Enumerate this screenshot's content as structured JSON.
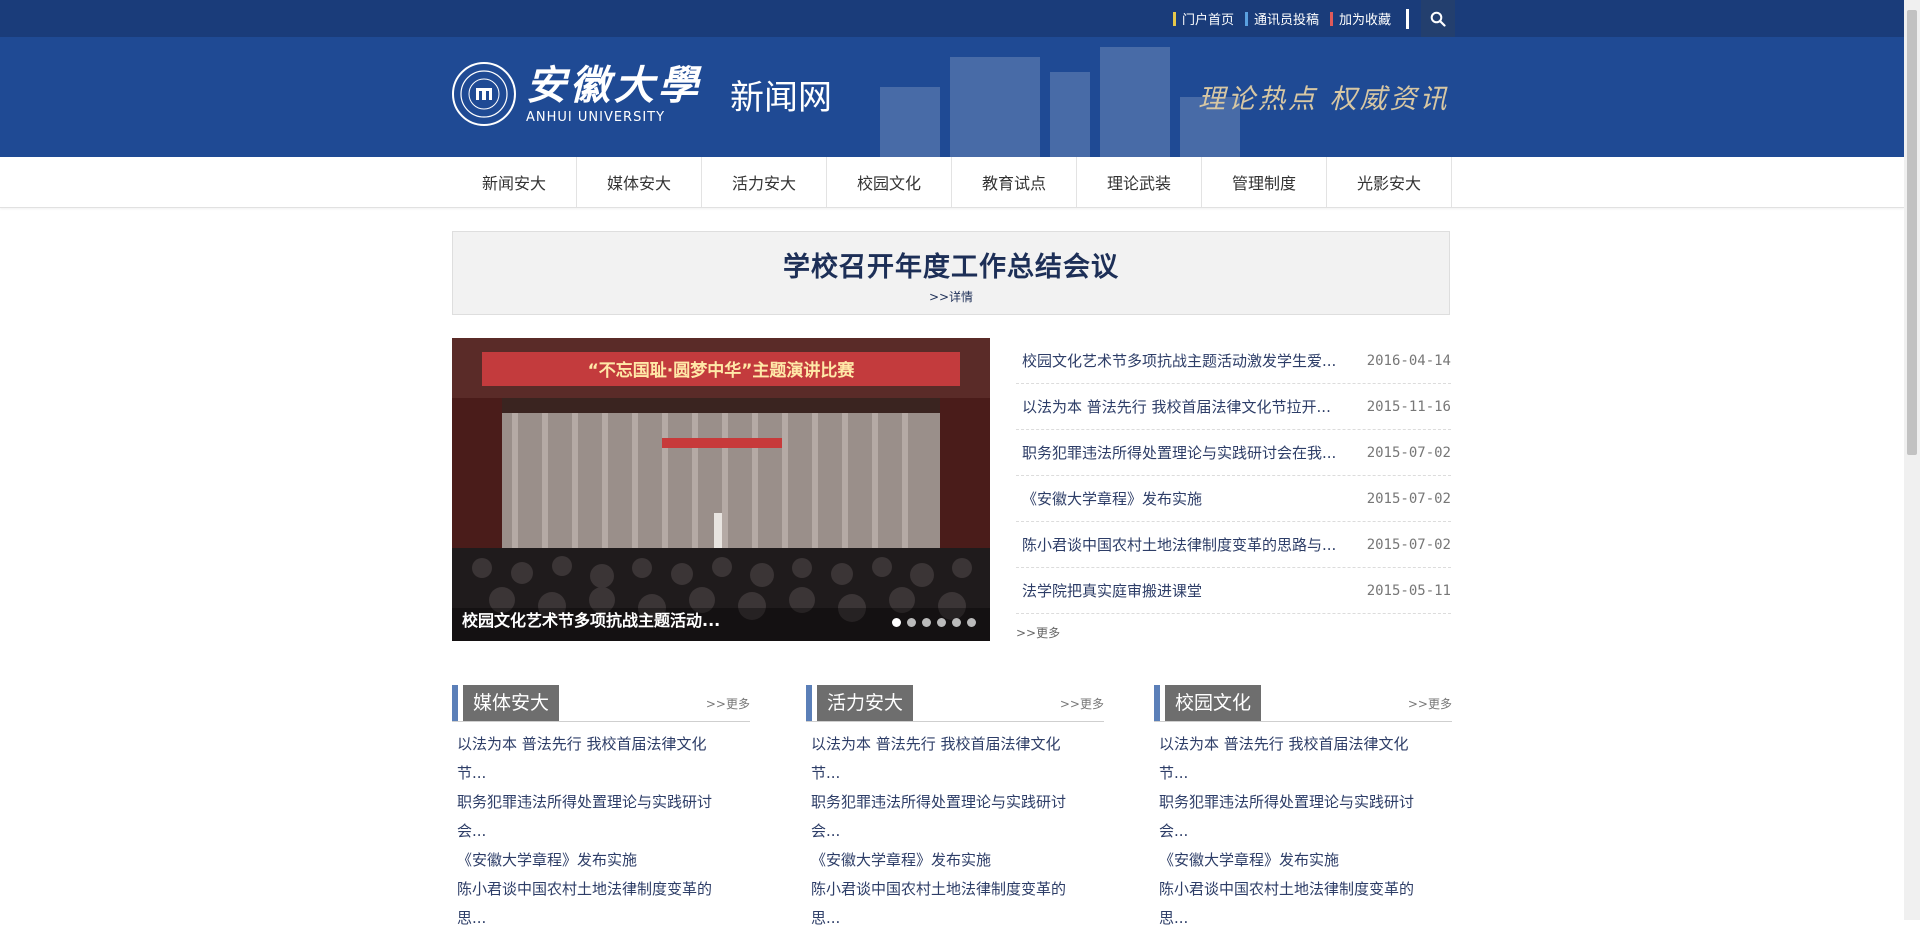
{
  "topbar": {
    "links": [
      {
        "label": "门户首页",
        "color": "#e6c84a"
      },
      {
        "label": "通讯员投稿",
        "color": "#5aa0e0"
      },
      {
        "label": "加为收藏",
        "color": "#e05a5a"
      }
    ],
    "search_icon": "search-icon"
  },
  "header": {
    "logo_cn": "安徽大學",
    "logo_en": "ANHUI UNIVERSITY",
    "site_name": "新闻网",
    "slogan": "理论热点 权威资讯"
  },
  "nav": {
    "items": [
      "新闻安大",
      "媒体安大",
      "活力安大",
      "校园文化",
      "教育试点",
      "理论武装",
      "管理制度",
      "光影安大"
    ]
  },
  "headline": {
    "title": "学校召开年度工作总结会议",
    "detail": ">>详情"
  },
  "slider": {
    "caption": "校园文化艺术节多项抗战主题活动...",
    "banner_text": "“不忘国耻·圆梦中华”主题演讲比赛",
    "dot_count": 6,
    "active_dot": 1
  },
  "news": {
    "items": [
      {
        "title": "校园文化艺术节多项抗战主题活动激发学生爱...",
        "date": "2016-04-14"
      },
      {
        "title": "以法为本 普法先行 我校首届法律文化节拉开...",
        "date": "2015-11-16"
      },
      {
        "title": "职务犯罪违法所得处置理论与实践研讨会在我...",
        "date": "2015-07-02"
      },
      {
        "title": "《安徽大学章程》发布实施",
        "date": "2015-07-02"
      },
      {
        "title": "陈小君谈中国农村土地法律制度变革的思路与...",
        "date": "2015-07-02"
      },
      {
        "title": "法学院把真实庭审搬进课堂",
        "date": "2015-05-11"
      }
    ],
    "more": ">>更多"
  },
  "columns": [
    {
      "title": "媒体安大",
      "more": ">>更多",
      "items": [
        "以法为本 普法先行 我校首届法律文化",
        "节...",
        "职务犯罪违法所得处置理论与实践研讨",
        "会...",
        "《安徽大学章程》发布实施",
        "陈小君谈中国农村土地法律制度变革的",
        "思..."
      ]
    },
    {
      "title": "活力安大",
      "more": ">>更多",
      "items": [
        "以法为本 普法先行 我校首届法律文化",
        "节...",
        "职务犯罪违法所得处置理论与实践研讨",
        "会...",
        "《安徽大学章程》发布实施",
        "陈小君谈中国农村土地法律制度变革的",
        "思..."
      ]
    },
    {
      "title": "校园文化",
      "more": ">>更多",
      "items": [
        "以法为本 普法先行 我校首届法律文化",
        "节...",
        "职务犯罪违法所得处置理论与实践研讨",
        "会...",
        "《安徽大学章程》发布实施",
        "陈小君谈中国农村土地法律制度变革的",
        "思..."
      ]
    }
  ]
}
